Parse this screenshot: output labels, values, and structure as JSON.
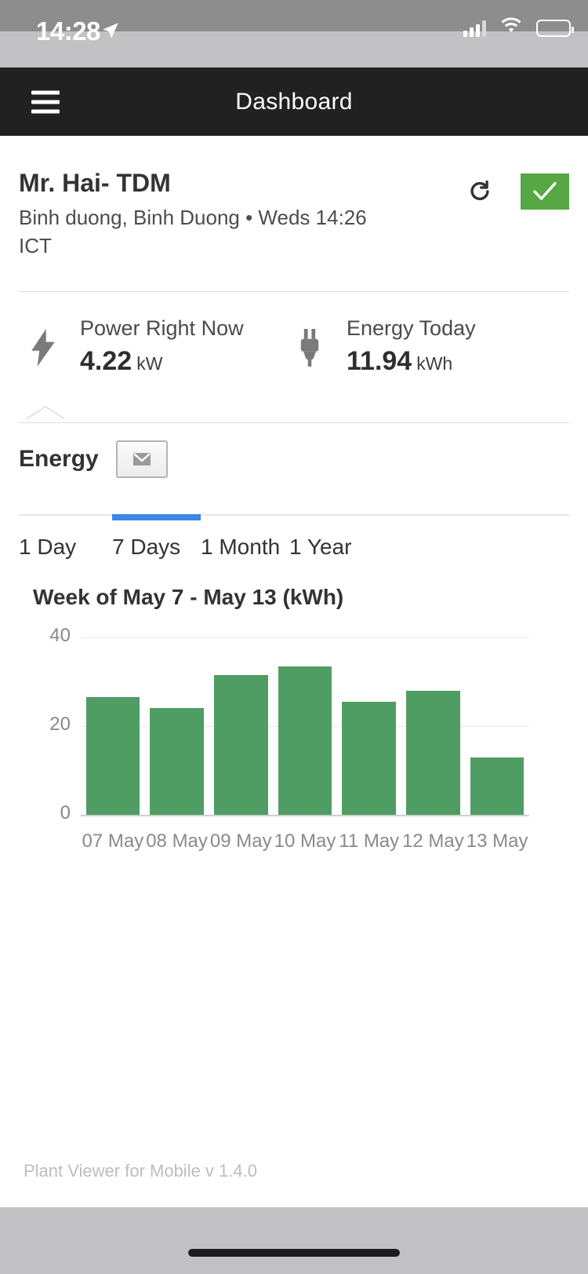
{
  "status_bar": {
    "time": "14:28",
    "location_icon": "location-arrow-icon",
    "signal_icon": "cellular-signal-icon",
    "wifi_icon": "wifi-icon",
    "battery_icon": "battery-icon"
  },
  "nav": {
    "menu_icon": "hamburger-menu-icon",
    "title": "Dashboard"
  },
  "site": {
    "name": "Mr. Hai- TDM",
    "subtitle": "Binh duong, Binh Duong • Weds 14:26 ICT",
    "refresh_icon": "refresh-icon",
    "status_icon": "checkmark-icon",
    "status_color": "#55a843"
  },
  "stats": [
    {
      "icon": "lightning-bolt-icon",
      "label": "Power Right Now",
      "value": "4.22",
      "unit": "kW"
    },
    {
      "icon": "power-plug-icon",
      "label": "Energy Today",
      "value": "11.94",
      "unit": "kWh"
    }
  ],
  "selector": {
    "label": "Energy",
    "dropdown_icon": "chevron-down-icon"
  },
  "tabs": {
    "items": [
      "1 Day",
      "7 Days",
      "1 Month",
      "1 Year"
    ],
    "active": "7 Days",
    "indicator_color": "#3d87e8"
  },
  "chart_data": {
    "type": "bar",
    "title": "Week of May 7 - May 13 (kWh)",
    "categories": [
      "07 May",
      "08 May",
      "09 May",
      "10 May",
      "11 May",
      "12 May",
      "13 May"
    ],
    "values": [
      26.5,
      24,
      31.5,
      33.5,
      25.5,
      28,
      13
    ],
    "xlabel": "",
    "ylabel": "",
    "ylim": [
      0,
      40
    ],
    "yticks": [
      0,
      20,
      40
    ],
    "ytick_labels": [
      "0",
      "20",
      "40"
    ],
    "grid": true,
    "legend": false,
    "bar_color": "#4f9d63"
  },
  "footer": {
    "version": "Plant Viewer for Mobile v 1.4.0"
  }
}
